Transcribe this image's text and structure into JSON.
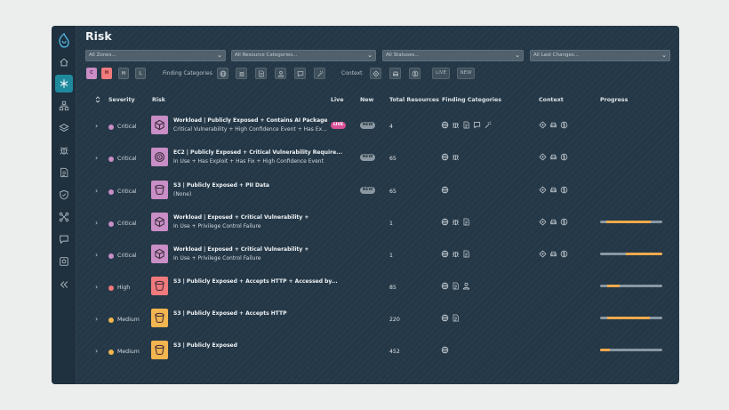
{
  "page": {
    "title": "Risk"
  },
  "colors": {
    "critical": "#c88ec5",
    "high": "#f07a7c",
    "medium": "#f2b54f",
    "accent": "#1f8a9e",
    "progress": "#f2a94e"
  },
  "sidebar": {
    "items": [
      {
        "icon": "home-icon",
        "active": false
      },
      {
        "icon": "asterisk-icon",
        "active": true
      },
      {
        "icon": "hierarchy-icon",
        "active": false
      },
      {
        "icon": "layers-icon",
        "active": false
      },
      {
        "icon": "bug-icon",
        "active": false
      },
      {
        "icon": "document-icon",
        "active": false
      },
      {
        "icon": "shield-icon",
        "active": false
      },
      {
        "icon": "network-icon",
        "active": false
      },
      {
        "icon": "chat-icon",
        "active": false
      },
      {
        "icon": "gear-icon",
        "active": false
      },
      {
        "icon": "collapse-icon",
        "active": false
      }
    ]
  },
  "filters": [
    {
      "placeholder": "All Zones..."
    },
    {
      "placeholder": "All Resource Categories..."
    },
    {
      "placeholder": "All Statuses..."
    },
    {
      "placeholder": "All Last Changes..."
    }
  ],
  "severity_chips": [
    "C",
    "H",
    "M",
    "L"
  ],
  "finding_categories_label": "Finding Categories",
  "context_label": "Context",
  "toggles": {
    "live": "LIVE",
    "new": "NEW"
  },
  "table": {
    "headers": {
      "severity": "Severity",
      "risk": "Risk",
      "live": "Live",
      "new": "New",
      "total": "Total Resources",
      "finding": "Finding Categories",
      "context": "Context",
      "progress": "Progress"
    },
    "rows": [
      {
        "severity": "Critical",
        "level": "critical",
        "icon": "workload-icon",
        "title": "Workload | Publicly Exposed + Contains AI Package",
        "subtitle": "Critical Vulnerability + High Confidence Event + Has Ex...",
        "live": "LIVE",
        "new": "NEW",
        "total": "4",
        "findings": [
          "globe-icon",
          "bug-icon",
          "document-icon",
          "chat-icon",
          "wand-icon"
        ],
        "context": [
          "crosshair-icon",
          "car-icon",
          "coins-icon"
        ],
        "progress": null
      },
      {
        "severity": "Critical",
        "level": "critical",
        "icon": "target-icon",
        "title": "EC2 | Publicly Exposed + Critical Vulnerability Require...",
        "subtitle": "In Use + Has Exploit + Has Fix + High Confidence Event",
        "live": "",
        "new": "NEW",
        "total": "65",
        "findings": [
          "globe-icon",
          "bug-icon"
        ],
        "context": [
          "crosshair-icon",
          "car-icon",
          "coins-icon"
        ],
        "progress": null
      },
      {
        "severity": "Critical",
        "level": "critical",
        "icon": "bucket-icon",
        "title": "S3 | Publicly Exposed + PII Data",
        "subtitle": "(None)",
        "live": "",
        "new": "NEW",
        "total": "65",
        "findings": [
          "globe-icon"
        ],
        "context": [
          "crosshair-icon",
          "car-icon",
          "coins-icon"
        ],
        "progress": null
      },
      {
        "severity": "Critical",
        "level": "critical",
        "icon": "workload-icon",
        "title": "Workload | Exposed + Critical Vulnerability +",
        "subtitle": "In Use + Privilege Control Failure",
        "live": "",
        "new": "",
        "total": "1",
        "findings": [
          "globe-icon",
          "bug-icon",
          "document-icon"
        ],
        "context": [
          "crosshair-icon",
          "car-icon",
          "coins-icon"
        ],
        "progress": {
          "start": 0.1,
          "end": 0.82
        }
      },
      {
        "severity": "Critical",
        "level": "critical",
        "icon": "workload-icon",
        "title": "Workload | Exposed + Critical Vulnerability +",
        "subtitle": "In Use + Privilege Control Failure",
        "live": "",
        "new": "",
        "total": "1",
        "findings": [
          "globe-icon",
          "bug-icon",
          "document-icon"
        ],
        "context": [
          "crosshair-icon",
          "car-icon",
          "coins-icon"
        ],
        "progress": {
          "start": 0.42,
          "end": 1.0
        }
      },
      {
        "severity": "High",
        "level": "high",
        "icon": "bucket-icon",
        "title": "S3 | Publicly Exposed + Accepts HTTP + Accessed by...",
        "subtitle": "",
        "live": "",
        "new": "",
        "total": "85",
        "findings": [
          "globe-icon",
          "document-icon",
          "user-icon"
        ],
        "context": [],
        "progress": {
          "start": 0.12,
          "end": 0.32
        }
      },
      {
        "severity": "Medium",
        "level": "medium",
        "icon": "bucket-icon",
        "title": "S3 | Publicly Exposed + Accepts HTTP",
        "subtitle": "",
        "live": "",
        "new": "",
        "total": "220",
        "findings": [
          "globe-icon",
          "document-icon"
        ],
        "context": [],
        "progress": {
          "start": 0.12,
          "end": 0.8
        }
      },
      {
        "severity": "Medium",
        "level": "medium",
        "icon": "bucket-icon",
        "title": "S3 | Publicly Exposed",
        "subtitle": "",
        "live": "",
        "new": "",
        "total": "452",
        "findings": [
          "globe-icon"
        ],
        "context": [],
        "progress": {
          "start": 0.0,
          "end": 0.16
        }
      }
    ]
  }
}
